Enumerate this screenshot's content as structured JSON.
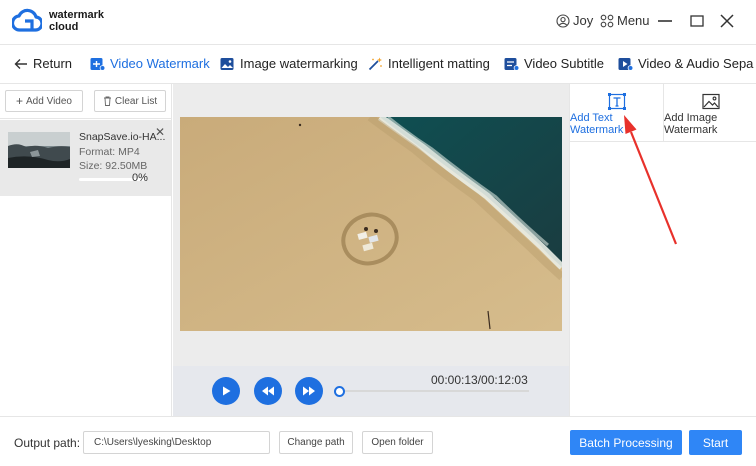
{
  "colors": {
    "accent": "#1e6fe0",
    "primary_button": "#2f86f6",
    "annotation_arrow": "#e8312b"
  },
  "titlebar": {
    "brand_line1": "watermark",
    "brand_line2": "cloud",
    "user_label": "Joy",
    "menu_label": "Menu",
    "icons": [
      "cloud-logo-icon",
      "user-icon",
      "menu-grid-icon",
      "minimize-icon",
      "maximize-icon",
      "close-icon"
    ]
  },
  "nav": {
    "return_label": "Return",
    "tabs": [
      {
        "label": "Video Watermark",
        "active": true,
        "icon": "video-watermark-icon"
      },
      {
        "label": "Image watermarking",
        "icon": "image-icon"
      },
      {
        "label": "Intelligent matting",
        "icon": "magic-wand-icon"
      },
      {
        "label": "Video Subtitle",
        "icon": "video-subtitle-icon"
      },
      {
        "label": "Video & Audio Sepa",
        "icon": "video-audio-icon"
      }
    ]
  },
  "filelist": {
    "add_video_label": "Add Video",
    "clear_list_label": "Clear List",
    "items": [
      {
        "name": "SnapSave.io-HA...",
        "format": "Format:  MP4",
        "size": "Size:  92.50MB",
        "progress_label": "0%",
        "progress": 0
      }
    ]
  },
  "player": {
    "timecode": "00:00:13/00:12:03",
    "seek_position": 0.01
  },
  "watermark_options": {
    "text_label": "Add Text Watermark",
    "image_label": "Add Image Watermark"
  },
  "bottombar": {
    "output_label": "Output path:",
    "output_path": "C:\\Users\\lyesking\\Desktop",
    "change_path_label": "Change path",
    "open_folder_label": "Open folder",
    "batch_label": "Batch Processing",
    "start_label": "Start"
  }
}
